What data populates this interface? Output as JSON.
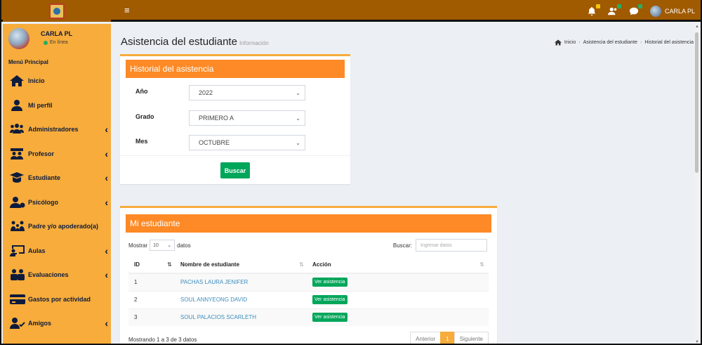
{
  "topbar": {
    "user_name": "CARLA PL",
    "icons": [
      "bell-icon",
      "users-icon",
      "chat-icon"
    ]
  },
  "sidebar": {
    "user_name": "CARLA PL",
    "user_status": "En línea",
    "menu_header": "Menú Principal",
    "items": [
      {
        "label": "Inicio",
        "icon": "home-icon",
        "has_children": false
      },
      {
        "label": "Mi perfil",
        "icon": "user-icon",
        "has_children": false
      },
      {
        "label": "Administradores",
        "icon": "users-icon",
        "has_children": true
      },
      {
        "label": "Profesor",
        "icon": "teacher-icon",
        "has_children": true
      },
      {
        "label": "Estudiante",
        "icon": "graduation-cap-icon",
        "has_children": true
      },
      {
        "label": "Psicólogo",
        "icon": "user-doctor-icon",
        "has_children": true
      },
      {
        "label": "Padre y/o apoderado(a)",
        "icon": "family-icon",
        "has_children": false
      },
      {
        "label": "Aulas",
        "icon": "chalkboard-icon",
        "has_children": true
      },
      {
        "label": "Evaluaciones",
        "icon": "people-icon",
        "has_children": true
      },
      {
        "label": "Gastos por actividad",
        "icon": "credit-card-icon",
        "has_children": false
      },
      {
        "label": "Amigos",
        "icon": "user-check-icon",
        "has_children": true
      }
    ]
  },
  "page": {
    "title": "Asistencia del estudiante",
    "subtitle": "Información",
    "breadcrumb": [
      "Inicio",
      "Asistencia del estudiante",
      "Historial del asistencia"
    ]
  },
  "filter_box": {
    "header": "Historial del asistencia",
    "year_label": "Año",
    "year_value": "2022",
    "grade_label": "Grado",
    "grade_value": "PRIMERO A",
    "month_label": "Mes",
    "month_value": "OCTUBRE",
    "search_button": "Buscar"
  },
  "students_box": {
    "header": "Mi estudiante",
    "show_label": "Mostrar",
    "page_length": "10",
    "records_label": "datos",
    "search_label": "Buscar:",
    "search_placeholder": "Ingresar datos",
    "columns": [
      "ID",
      "Nombre de estudiante",
      "Acción"
    ],
    "rows": [
      {
        "id": "1",
        "name": "PACHAS LAURA JENIFER",
        "action": "Ver asistencia"
      },
      {
        "id": "2",
        "name": "SOUL ANNYEONG DAVID",
        "action": "Ver asistencia"
      },
      {
        "id": "3",
        "name": "SOUL PALACIOS SCARLETH",
        "action": "Ver asistencia"
      }
    ],
    "info": "Mostrando 1 a 3 de 3 datos",
    "pager": {
      "prev": "Anterior",
      "current": "1",
      "next": "Siguiente"
    }
  },
  "colors": {
    "topbar": "#a05a00",
    "sidebar": "#f7ac3b",
    "box_header": "#fd8a26",
    "button_green": "#00a65a",
    "link": "#3c8dbc"
  }
}
